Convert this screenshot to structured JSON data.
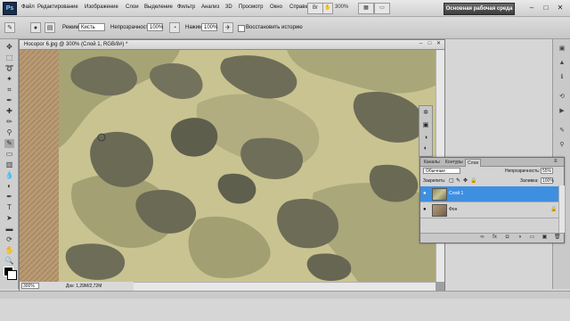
{
  "app": {
    "logo": "Ps",
    "menu": [
      "Файл",
      "Редактирование",
      "Изображение",
      "Слои",
      "Выделение",
      "Фильтр",
      "Анализ",
      "3D",
      "Просмотр",
      "Окно",
      "Справка"
    ],
    "zoom": "300%",
    "workspace": "Основная рабочая среда",
    "window_controls": [
      "–",
      "□",
      "✕"
    ]
  },
  "options": {
    "mode_label": "Режим:",
    "mode_value": "Кисть",
    "opacity_label": "Непрозрачность:",
    "opacity_value": "100%",
    "pressure_label": "Нажим:",
    "pressure_value": "100%",
    "history_label": "Восстановить историю"
  },
  "document": {
    "title": "Носорог 6.jpg @ 300% (Слой 1, RGB/8#) *",
    "status_zoom": "300%",
    "status_doc": "Док: 1,29M/2,72M"
  },
  "layers_panel": {
    "tabs": [
      "Каналы",
      "Контуры",
      "Слои"
    ],
    "active_tab": "Слои",
    "blend_mode": "Обычные",
    "opacity_label": "Непрозрачность:",
    "opacity_value": "55%",
    "lock_label": "Закрепить:",
    "fill_label": "Заливка:",
    "fill_value": "100%",
    "layers": [
      {
        "name": "Слой 1",
        "selected": true
      },
      {
        "name": "Фон",
        "selected": false,
        "locked": true
      }
    ]
  },
  "colors": {
    "camo_base": "#c9c391",
    "camo_olive": "#9c9968",
    "camo_dark": "#6f6f5a",
    "selection": "#3e8fe0"
  }
}
